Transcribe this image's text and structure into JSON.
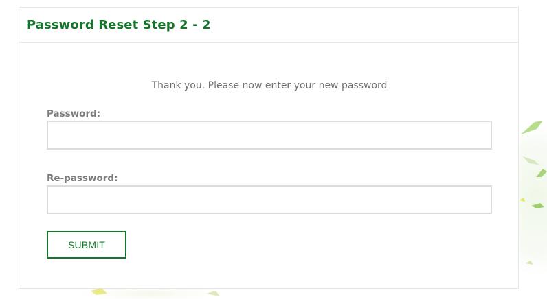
{
  "header": {
    "title": "Password Reset Step 2 - 2"
  },
  "form": {
    "instruction": "Thank you. Please now enter your new password",
    "password_label": "Password:",
    "password_value": "",
    "repassword_label": "Re-password:",
    "repassword_value": "",
    "submit_label": "SUBMIT"
  },
  "colors": {
    "accent": "#15762b",
    "border": "#e6e6e6",
    "input_border": "#dcdcdc",
    "label_text": "#7b7b7b",
    "instruction_text": "#6f6f6f"
  }
}
